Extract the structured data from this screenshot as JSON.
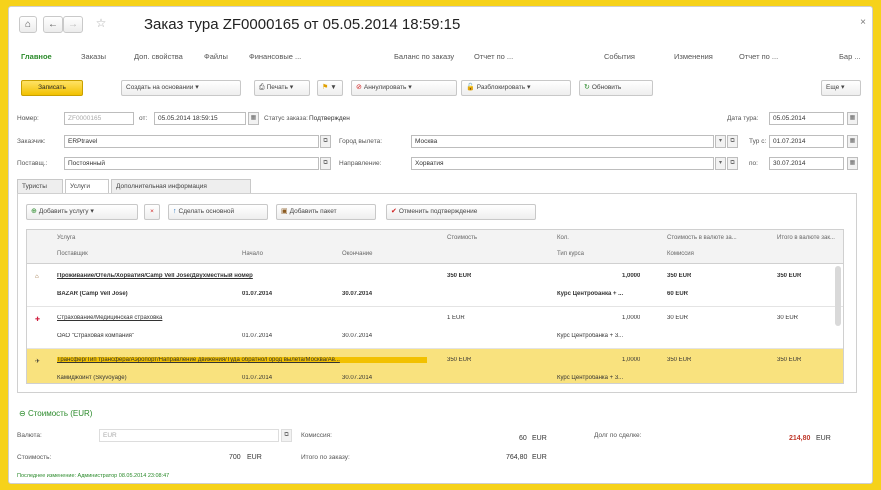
{
  "nav": {
    "home": "⌂",
    "back": "←",
    "forward": "→",
    "star": "☆"
  },
  "title": "Заказ тура ZF0000165 от 05.05.2014 18:59:15",
  "close": "×",
  "tabs": [
    "Главное",
    "Заказы",
    "Доп. свойства",
    "Файлы",
    "Финансовые ...",
    "Баланс по заказу",
    "Отчет по ...",
    "События",
    "Изменения",
    "Отчет по ...",
    "Бар ..."
  ],
  "toolbar": {
    "save": "Записать",
    "create": "Создать на основании",
    "print": "Печать",
    "flag": "▼",
    "annul": "Аннулировать",
    "unblock": "Разблокировать",
    "refresh": "Обновить",
    "more": "Еще"
  },
  "header": {
    "number_label": "Номер:",
    "number_value": "ZF0000165",
    "from_label": "от:",
    "date_value": "05.05.2014 18:59:15",
    "status_label": "Статус заказа:",
    "status_value": "Подтвержден",
    "tour_date_label": "Дата тура:",
    "tour_date_value": "05.05.2014",
    "customer_label": "Заказчик:",
    "customer_value": "ERPtravel",
    "departure_label": "Город вылета:",
    "departure_value": "Москва",
    "tour_from_label": "Тур с:",
    "tour_from_value": "01.07.2014",
    "partner_label": "Поставщ.:",
    "partner_value": "Постоянный",
    "direction_label": "Направление:",
    "direction_value": "Хорватия",
    "to_label": "по:",
    "to_value": "30.07.2014"
  },
  "subtabs": [
    "Туристы",
    "Услуги",
    "Дополнительная информация"
  ],
  "subtoolbar": {
    "add": "Добавить услугу",
    "delete": "×",
    "make_main": "Сделать основной",
    "add_package": "Добавить пакет",
    "cancel_confirm": "Отменить подтверждение"
  },
  "grid": {
    "headers": {
      "service": "Услуга",
      "supplier": "Поставщик",
      "start": "Начало",
      "end": "Окончание",
      "cost": "Стоимость",
      "count": "Кол.",
      "rate": "Тип курса",
      "value_cur": "Стоимость в валюте за...",
      "commission": "Комиссия",
      "total_cur": "Итого в валюте зак..."
    },
    "rows": [
      {
        "icon": "⌂",
        "service": "Проживание/Отель/Хорватия/Camp Vell Jose/Двухместный номер",
        "supplier": "BAZAR (Camp Vell Jose)",
        "start": "01.07.2014",
        "end": "30.07.2014",
        "cost": "350 EUR",
        "count": "1,0000",
        "rate": "Курс Центробанка + ...",
        "value_cur": "350 EUR",
        "commission": "60 EUR",
        "total": "350 EUR"
      },
      {
        "icon": "✚",
        "service": "Страхование/Медицинская страховка",
        "supplier": "ОАО \"Страховая компания\"",
        "start": "01.07.2014",
        "end": "30.07.2014",
        "cost": "1 EUR",
        "count": "1,0000",
        "rate": "Курс Центробанка + 3...",
        "value_cur": "30 EUR",
        "commission": "",
        "total": "30 EUR"
      },
      {
        "icon": "✈",
        "service": "Трансфер/Тип трансфера/Аэропорт/Направление движения/Туда обратно/Город вылета/Москва/Ав...",
        "supplier": "Камиджойнт (Skyvoyage)",
        "start": "01.07.2014",
        "end": "30.07.2014",
        "cost": "350 EUR",
        "count": "1,0000",
        "rate": "Курс Центробанка + 3...",
        "value_cur": "350 EUR",
        "commission": "",
        "total": "350 EUR"
      }
    ]
  },
  "bottom": {
    "section_title": "Стоимость (EUR)",
    "currency_label": "Валюта:",
    "currency_value": "EUR",
    "commission_label": "Комиссия:",
    "commission_value": "60",
    "commission_cur": "EUR",
    "debt_label": "Долг по сделке:",
    "debt_value": "214,80",
    "debt_cur": "EUR",
    "cost_label": "Стоимость:",
    "cost_value": "700",
    "cost_cur": "EUR",
    "total_label": "Итого по заказу:",
    "total_value": "764,80",
    "total_cur": "EUR",
    "footer": "Последнее изменение: Администратор 08.05.2014 23:08:47"
  }
}
